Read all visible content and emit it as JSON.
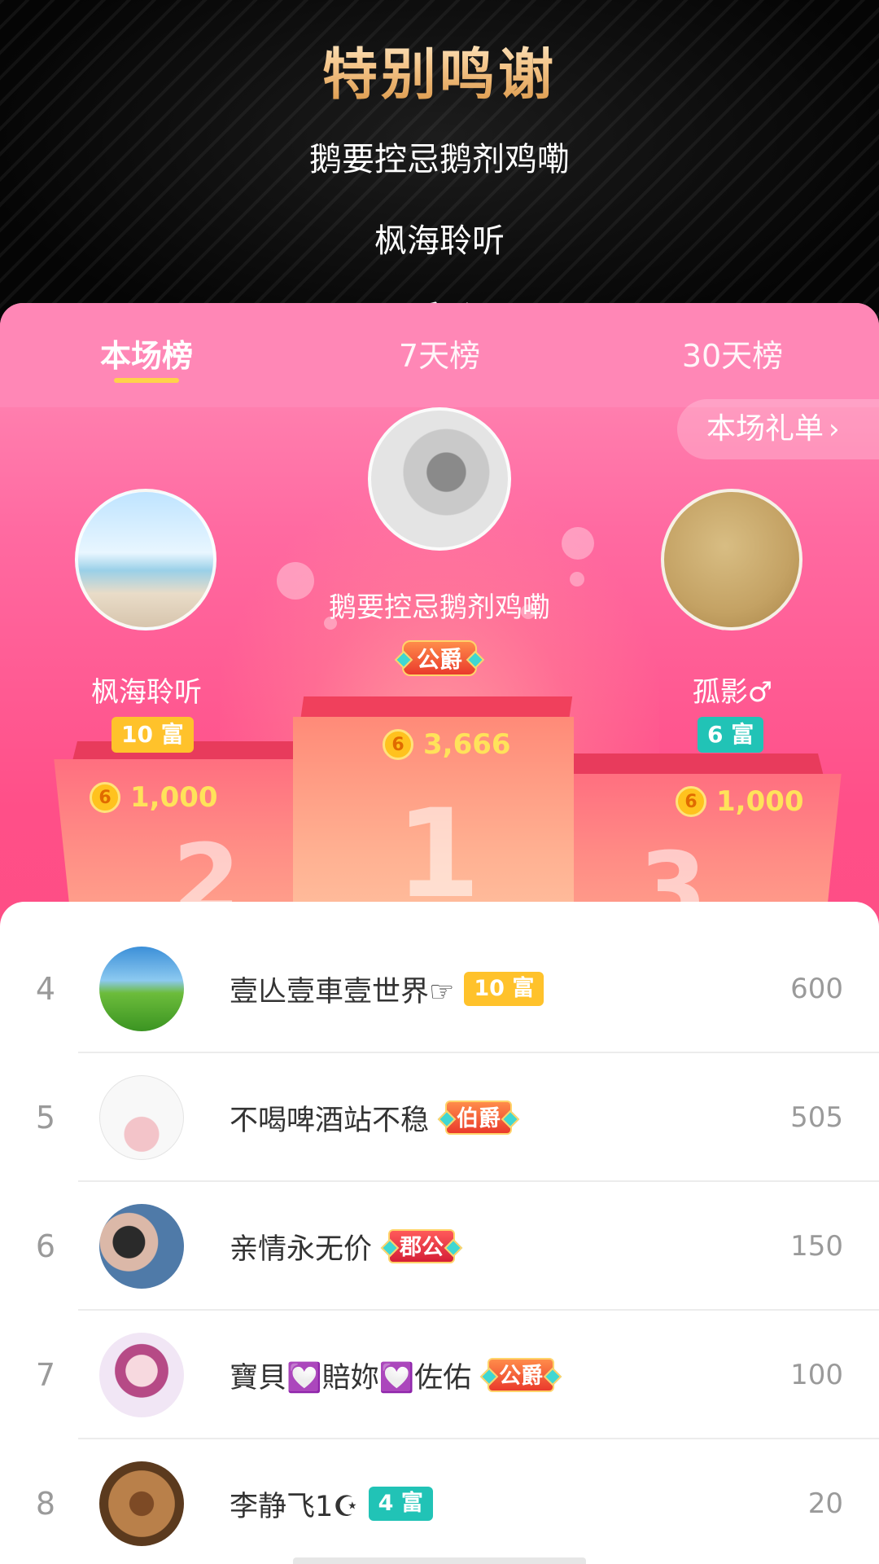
{
  "banner": {
    "title": "特别鸣谢",
    "thanks": [
      "鹅要控忌鹅剂鸡嘞",
      "枫海聆听",
      "孤影"
    ]
  },
  "tabs": [
    {
      "label": "本场榜",
      "active": true
    },
    {
      "label": "7天榜",
      "active": false
    },
    {
      "label": "30天榜",
      "active": false
    }
  ],
  "gift_list": {
    "label": "本场礼单",
    "icon": "chevron-right-icon"
  },
  "podium": {
    "first": {
      "name": "鹅要控忌鹅剂鸡嘞",
      "badge": "公爵",
      "coins": "3,666",
      "place": "1"
    },
    "second": {
      "name": "枫海聆听",
      "badge": "10 富",
      "coins": "1,000",
      "place": "2"
    },
    "third": {
      "name": "孤影♂",
      "badge": "6 富",
      "coins": "1,000",
      "place": "3"
    },
    "coin_symbol": "6"
  },
  "list": [
    {
      "rank": "4",
      "name": "壹亾壹車壹世界☞",
      "badge": "10 富",
      "badge_type": "gold",
      "score": "600"
    },
    {
      "rank": "5",
      "name": "不喝啤酒站不稳",
      "badge": "伯爵",
      "badge_type": "title",
      "score": "505"
    },
    {
      "rank": "6",
      "name": "亲情永无价",
      "badge": "郡公",
      "badge_type": "title-red",
      "score": "150"
    },
    {
      "rank": "7",
      "name": "寶貝💟賠妳💟佐佑",
      "badge": "公爵",
      "badge_type": "title",
      "score": "100"
    },
    {
      "rank": "8",
      "name": "李静飞1☪",
      "badge": "4 富",
      "badge_type": "teal",
      "score": "20"
    }
  ],
  "colors": {
    "title_gold": "#f3c58d",
    "panel_pink": "#ff4f88",
    "tab_bar": "#ff87b6",
    "active_underline": "#ffd24a",
    "coin_text": "#ffe25a",
    "badge_gold": "#ffc22b",
    "badge_teal": "#21c3b6"
  }
}
